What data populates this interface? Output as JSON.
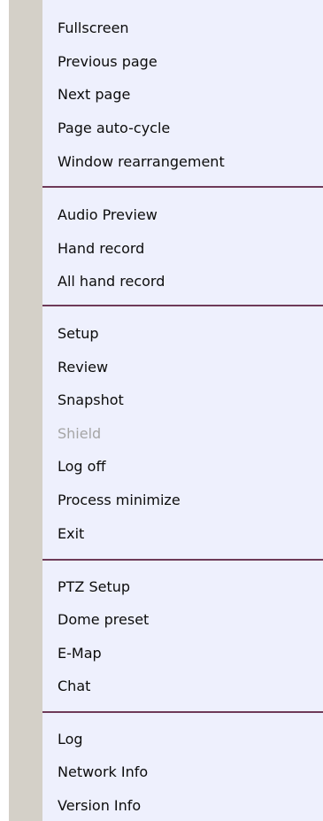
{
  "colors": {
    "menu_background": "#eef0fd",
    "gutter": "#d4d0c8",
    "separator": "#6e3a58",
    "text": "#0c0c0c",
    "disabled_text": "#a5a5a5"
  },
  "menu": {
    "groups": [
      {
        "items": [
          {
            "label": "Fullscreen",
            "enabled": true
          },
          {
            "label": "Previous page",
            "enabled": true
          },
          {
            "label": "Next page",
            "enabled": true
          },
          {
            "label": "Page auto-cycle",
            "enabled": true
          },
          {
            "label": "Window rearrangement",
            "enabled": true
          }
        ]
      },
      {
        "items": [
          {
            "label": "Audio Preview",
            "enabled": true
          },
          {
            "label": "Hand record",
            "enabled": true
          },
          {
            "label": "All hand record",
            "enabled": true
          }
        ]
      },
      {
        "items": [
          {
            "label": "Setup",
            "enabled": true
          },
          {
            "label": "Review",
            "enabled": true
          },
          {
            "label": "Snapshot",
            "enabled": true
          },
          {
            "label": "Shield",
            "enabled": false
          },
          {
            "label": "Log off",
            "enabled": true
          },
          {
            "label": "Process minimize",
            "enabled": true
          },
          {
            "label": "Exit",
            "enabled": true
          }
        ]
      },
      {
        "items": [
          {
            "label": "PTZ Setup",
            "enabled": true
          },
          {
            "label": "Dome preset",
            "enabled": true
          },
          {
            "label": "E-Map",
            "enabled": true
          },
          {
            "label": "Chat",
            "enabled": true
          }
        ]
      },
      {
        "items": [
          {
            "label": "Log",
            "enabled": true
          },
          {
            "label": "Network Info",
            "enabled": true
          },
          {
            "label": "Version Info",
            "enabled": true
          }
        ]
      }
    ]
  }
}
